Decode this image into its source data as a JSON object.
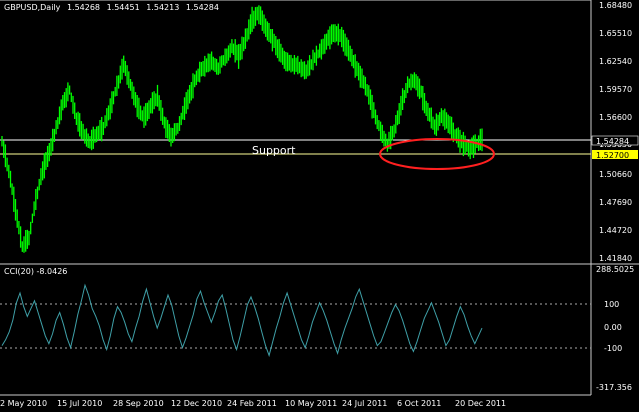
{
  "chart_data": [
    {
      "type": "candlestick",
      "header": {
        "symbol": "GBPUSD,Daily",
        "open": "1.54268",
        "high": "1.54451",
        "low": "1.54213",
        "close": "1.54284"
      },
      "y_ticks": [
        "1.68480",
        "1.65510",
        "1.62540",
        "1.59570",
        "1.56600",
        "1.53630",
        "1.50660",
        "1.47690",
        "1.44720",
        "1.41840"
      ],
      "ylim": [
        1.4184,
        1.6848
      ],
      "price_tag": "1.54284",
      "support_tag": "1.52700",
      "support_value": 1.527,
      "support_label": "Support",
      "x_ticks": [
        "2 May 2010",
        "15 Jul 2010",
        "28 Sep 2010",
        "12 Dec 2010",
        "24 Feb 2011",
        "10 May 2011",
        "24 Jul 2011",
        "6 Oct 2011",
        "20 Dec 2011"
      ],
      "close_series": [
        1.54,
        1.51,
        1.47,
        1.43,
        1.44,
        1.48,
        1.51,
        1.53,
        1.555,
        1.58,
        1.595,
        1.565,
        1.55,
        1.54,
        1.548,
        1.556,
        1.575,
        1.598,
        1.622,
        1.6,
        1.578,
        1.565,
        1.578,
        1.588,
        1.56,
        1.545,
        1.555,
        1.575,
        1.595,
        1.61,
        1.62,
        1.625,
        1.618,
        1.628,
        1.64,
        1.63,
        1.648,
        1.668,
        1.675,
        1.66,
        1.648,
        1.635,
        1.625,
        1.622,
        1.618,
        1.615,
        1.625,
        1.635,
        1.645,
        1.655,
        1.652,
        1.64,
        1.625,
        1.61,
        1.595,
        1.572,
        1.552,
        1.538,
        1.552,
        1.578,
        1.6,
        1.605,
        1.592,
        1.572,
        1.556,
        1.566,
        1.56,
        1.548,
        1.54,
        1.532,
        1.538,
        1.543
      ],
      "grid": false
    },
    {
      "type": "line",
      "header": "CCI(20) -8.0426",
      "y_ticks": [
        "288.5025",
        "100",
        "0.00",
        "-100",
        "-317.356"
      ],
      "ylim": [
        -317.356,
        288.5025
      ],
      "levels": [
        100,
        -100
      ],
      "series": [
        {
          "values": [
            -110,
            -80,
            -40,
            20,
            110,
            160,
            90,
            40,
            80,
            120,
            60,
            0,
            -60,
            -100,
            -50,
            20,
            60,
            0,
            -70,
            -120,
            -40,
            50,
            120,
            200,
            150,
            80,
            40,
            -10,
            -80,
            -130,
            -60,
            30,
            90,
            60,
            10,
            -50,
            -90,
            -20,
            40,
            120,
            180,
            110,
            40,
            -20,
            30,
            90,
            150,
            100,
            20,
            -60,
            -120,
            -70,
            -10,
            50,
            130,
            170,
            110,
            60,
            10,
            60,
            120,
            150,
            80,
            0,
            -80,
            -130,
            -60,
            20,
            100,
            140,
            90,
            30,
            -40,
            -110,
            -160,
            -90,
            -20,
            40,
            110,
            160,
            100,
            40,
            -20,
            -80,
            -120,
            -60,
            10,
            60,
            110,
            70,
            20,
            -40,
            -100,
            -150,
            -80,
            -20,
            30,
            80,
            140,
            180,
            120,
            60,
            0,
            -60,
            -110,
            -90,
            -40,
            10,
            60,
            100,
            70,
            20,
            -40,
            -100,
            -140,
            -90,
            -30,
            30,
            70,
            110,
            60,
            10,
            -50,
            -110,
            -80,
            -20,
            40,
            90,
            50,
            -10,
            -60,
            -100,
            -60,
            -20
          ]
        }
      ],
      "grid": false
    }
  ],
  "colors": {
    "candle": "#00ff00",
    "cci": "#3fa0a8",
    "support_line": "#ffff99",
    "resistance_line": "#ffffff",
    "ellipse": "#ff2020",
    "tag_bg": "#ffff00"
  }
}
